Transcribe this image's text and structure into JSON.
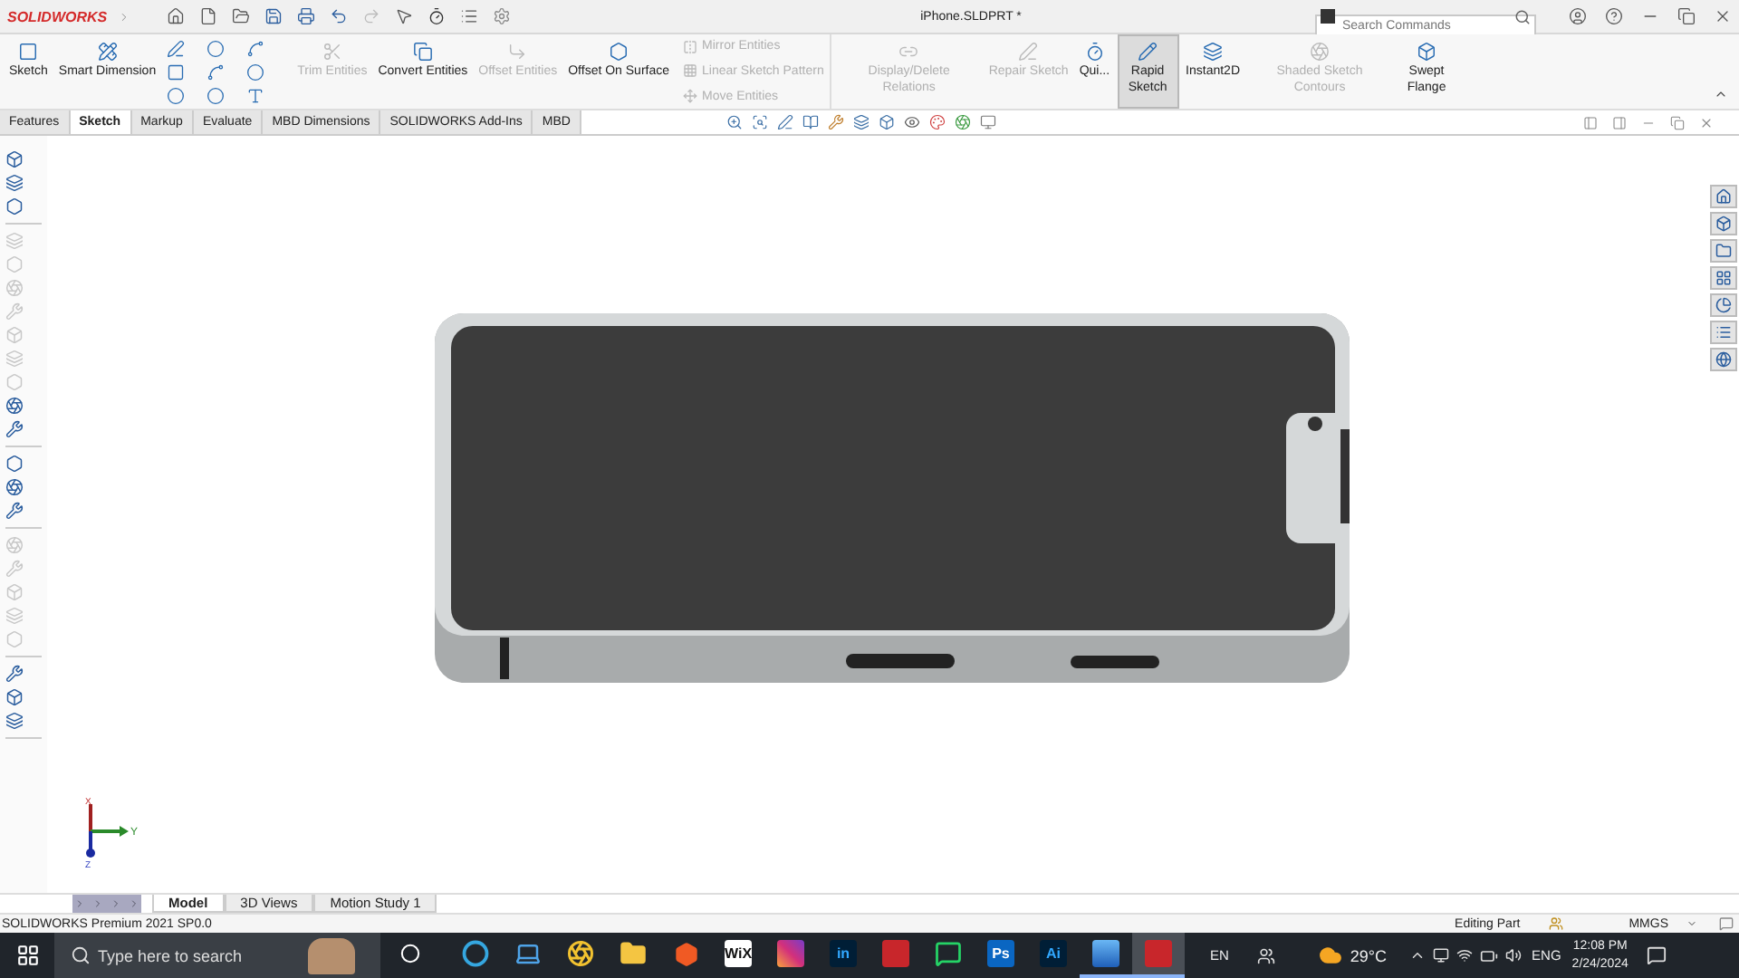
{
  "title_bar": {
    "app_name": "SOLIDWORKS",
    "document_title": "iPhone.SLDPRT *",
    "search": {
      "placeholder": "Search Commands"
    }
  },
  "ribbon": [
    {
      "kind": "button",
      "label": "Sketch",
      "disabled": false,
      "selected": false
    },
    {
      "kind": "button",
      "label": "Smart Dimension",
      "disabled": false,
      "selected": false
    },
    {
      "kind": "grid"
    },
    {
      "kind": "button",
      "label": "Trim Entities",
      "disabled": true,
      "selected": false
    },
    {
      "kind": "button",
      "label": "Convert Entities",
      "disabled": false,
      "selected": false
    },
    {
      "kind": "button",
      "label": "Offset Entities",
      "disabled": true,
      "selected": false
    },
    {
      "kind": "button",
      "label": "Offset On Surface",
      "disabled": false,
      "selected": false
    },
    {
      "kind": "list",
      "items": [
        {
          "label": "Mirror Entities",
          "disabled": true
        },
        {
          "label": "Linear Sketch Pattern",
          "disabled": true
        },
        {
          "label": "Move Entities",
          "disabled": true
        }
      ]
    },
    {
      "kind": "button",
      "label": "Display/Delete Relations",
      "disabled": true,
      "selected": false
    },
    {
      "kind": "button",
      "label": "Repair Sketch",
      "disabled": true,
      "selected": false
    },
    {
      "kind": "button",
      "label": "Qui...",
      "disabled": false,
      "selected": false
    },
    {
      "kind": "button",
      "label": "Rapid Sketch",
      "disabled": false,
      "selected": true
    },
    {
      "kind": "button",
      "label": "Instant2D",
      "disabled": false,
      "selected": false
    },
    {
      "kind": "button",
      "label": "Shaded Sketch Contours",
      "disabled": true,
      "selected": false
    },
    {
      "kind": "button",
      "label": "Swept Flange",
      "disabled": false,
      "selected": false
    }
  ],
  "tabs": [
    {
      "label": "Features",
      "selected": false
    },
    {
      "label": "Sketch",
      "selected": true
    },
    {
      "label": "Markup",
      "selected": false
    },
    {
      "label": "Evaluate",
      "selected": false
    },
    {
      "label": "MBD Dimensions",
      "selected": false
    },
    {
      "label": "SOLIDWORKS Add-Ins",
      "selected": false
    },
    {
      "label": "MBD",
      "selected": false
    }
  ],
  "feature_toolbar": [
    [
      {
        "disabled": false
      },
      {
        "disabled": false
      },
      {
        "disabled": false
      }
    ],
    [
      {
        "disabled": true
      },
      {
        "disabled": true
      },
      {
        "disabled": true
      },
      {
        "disabled": true
      },
      {
        "disabled": true
      },
      {
        "disabled": true
      },
      {
        "disabled": true
      },
      {
        "disabled": false
      },
      {
        "disabled": false
      }
    ],
    [
      {
        "disabled": false
      },
      {
        "disabled": false
      },
      {
        "disabled": false
      }
    ],
    [
      {
        "disabled": true
      },
      {
        "disabled": true
      },
      {
        "disabled": true
      },
      {
        "disabled": true
      },
      {
        "disabled": true
      }
    ],
    [
      {
        "disabled": false
      },
      {
        "disabled": false
      },
      {
        "disabled": false
      }
    ]
  ],
  "triad": {
    "x": "X",
    "y": "Y",
    "z": "Z"
  },
  "bottom_tabs": [
    {
      "label": "Model",
      "selected": true
    },
    {
      "label": "3D Views",
      "selected": false
    },
    {
      "label": "Motion Study 1",
      "selected": false
    }
  ],
  "status_bar": {
    "product": "SOLIDWORKS Premium 2021 SP0.0",
    "mode": "Editing Part",
    "units": "MMGS"
  },
  "taskbar": {
    "search": {
      "placeholder": "Type here to search"
    },
    "apps": [
      {
        "kind": "edge",
        "running": false,
        "active": false
      },
      {
        "kind": "laptop",
        "running": false,
        "active": false
      },
      {
        "kind": "chrome",
        "running": false,
        "active": false
      },
      {
        "kind": "folder",
        "running": false,
        "active": false
      },
      {
        "kind": "brave",
        "running": false,
        "active": false
      },
      {
        "kind": "tile",
        "glyph": "WiX",
        "running": false,
        "active": false
      },
      {
        "kind": "instagram",
        "running": false,
        "active": false
      },
      {
        "kind": "tile",
        "glyph": "in",
        "running": false,
        "active": false
      },
      {
        "kind": "sw",
        "running": false,
        "active": false
      },
      {
        "kind": "whatsapp",
        "running": false,
        "active": false
      },
      {
        "kind": "tile",
        "glyph": "Ps",
        "running": false,
        "active": false
      },
      {
        "kind": "tile",
        "glyph": "Ai",
        "running": false,
        "active": false
      },
      {
        "kind": "photos",
        "running": true,
        "active": false
      },
      {
        "kind": "sw",
        "running": true,
        "active": true
      }
    ],
    "input_indicator": "EN",
    "temperature": "29°C",
    "language": "ENG",
    "time": "12:08 PM",
    "date": "2/24/2024"
  }
}
